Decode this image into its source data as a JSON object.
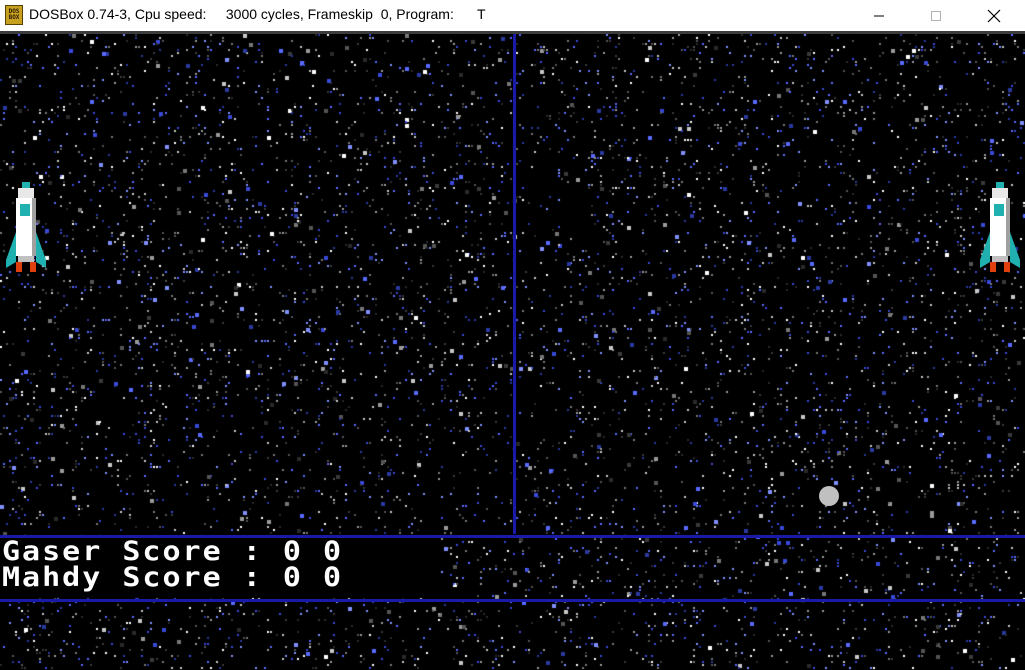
{
  "window": {
    "title": "DOSBox 0.74-3, Cpu speed:     3000 cycles, Frameskip  0, Program:      T",
    "icon": "dosbox-icon",
    "icon_text_top": "DOS",
    "icon_text_bottom": "BOX",
    "controls": [
      "minimize",
      "maximize",
      "close"
    ]
  },
  "game": {
    "background_color": "#000000",
    "divider_color": "#1a1aa8",
    "ball_color": "#c0c0c0",
    "scores": [
      {
        "name": "Gaser",
        "label": "Score",
        "separator": ":",
        "value": "0 0"
      },
      {
        "name": "Mahdy",
        "label": "Score",
        "separator": ":",
        "value": "0 0"
      }
    ]
  }
}
